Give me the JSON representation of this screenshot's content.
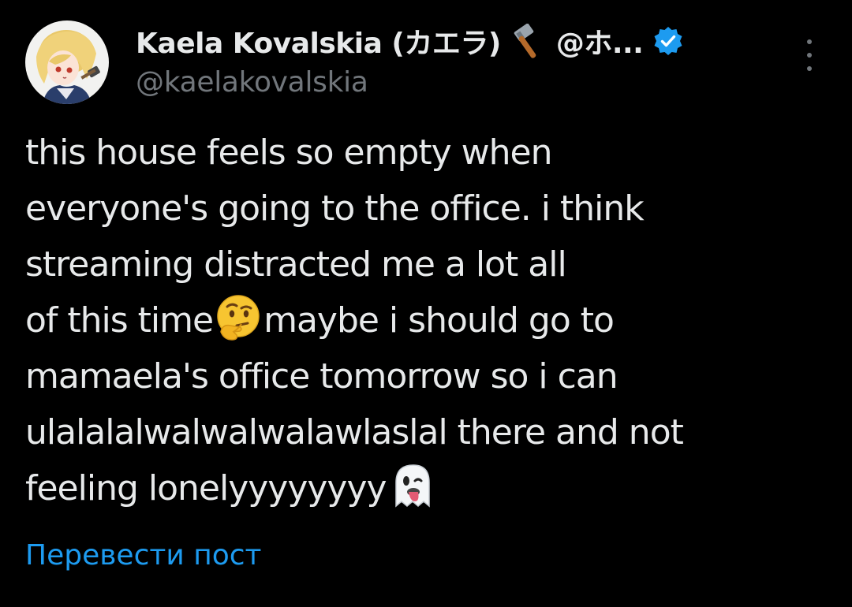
{
  "author": {
    "display_name": "Kaela Kovalskia (カエラ)",
    "handle_truncated": "@ホ...",
    "username": "@kaelakovalskia",
    "name_emoji": "hammer-icon",
    "verified": true,
    "avatar": "avatar-image"
  },
  "tweet": {
    "lines": [
      "this house feels so empty when",
      "everyone's going to the office. i think",
      "streaming distracted me a lot all",
      "of this time",
      "maybe i should go to",
      "mamaela's office tomorrow so i can",
      "ulalalalwalwalwalawlaslal there and not",
      "feeling lonelyyyyyyyy"
    ],
    "emojis": [
      "thinking-face-emoji",
      "ghost-emoji"
    ]
  },
  "translate_label": "Перевести пост",
  "colors": {
    "background": "#000000",
    "text": "#e7e9ea",
    "secondary": "#71767b",
    "link": "#1d9bf0",
    "verified": "#1d9bf0"
  },
  "icons": {
    "more": "more-options-icon",
    "verified": "verified-badge-icon"
  }
}
